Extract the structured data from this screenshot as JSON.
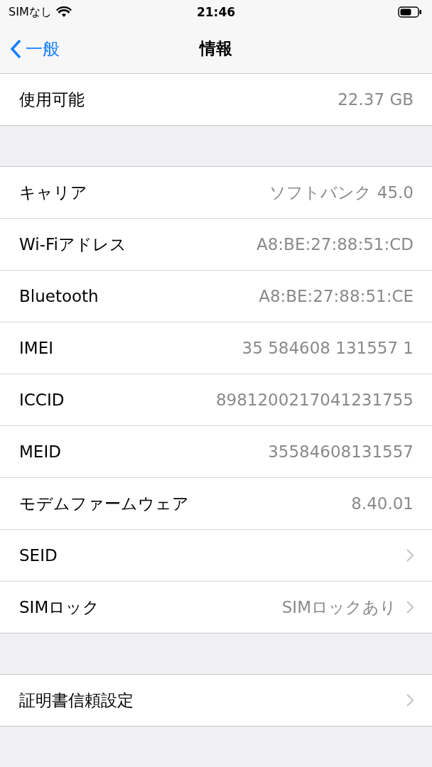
{
  "status_bar": {
    "carrier": "SIMなし",
    "time": "21:46"
  },
  "nav": {
    "back": "一般",
    "title": "情報"
  },
  "sections": [
    {
      "rows": [
        {
          "label": "使用可能",
          "value": "22.37 GB",
          "chevron": false
        }
      ]
    },
    {
      "rows": [
        {
          "label": "キャリア",
          "value": "ソフトバンク 45.0",
          "chevron": false
        },
        {
          "label": "Wi-Fiアドレス",
          "value": "A8:BE:27:88:51:CD",
          "chevron": false
        },
        {
          "label": "Bluetooth",
          "value": "A8:BE:27:88:51:CE",
          "chevron": false
        },
        {
          "label": "IMEI",
          "value": "35 584608 131557 1",
          "chevron": false
        },
        {
          "label": "ICCID",
          "value": "8981200217041231755",
          "chevron": false
        },
        {
          "label": "MEID",
          "value": "35584608131557",
          "chevron": false
        },
        {
          "label": "モデムファームウェア",
          "value": "8.40.01",
          "chevron": false
        },
        {
          "label": "SEID",
          "chevron": true
        },
        {
          "label": "SIMロック",
          "value": "SIMロックあり",
          "chevron": true
        }
      ]
    },
    {
      "rows": [
        {
          "label": "証明書信頼設定",
          "chevron": true
        }
      ]
    }
  ]
}
